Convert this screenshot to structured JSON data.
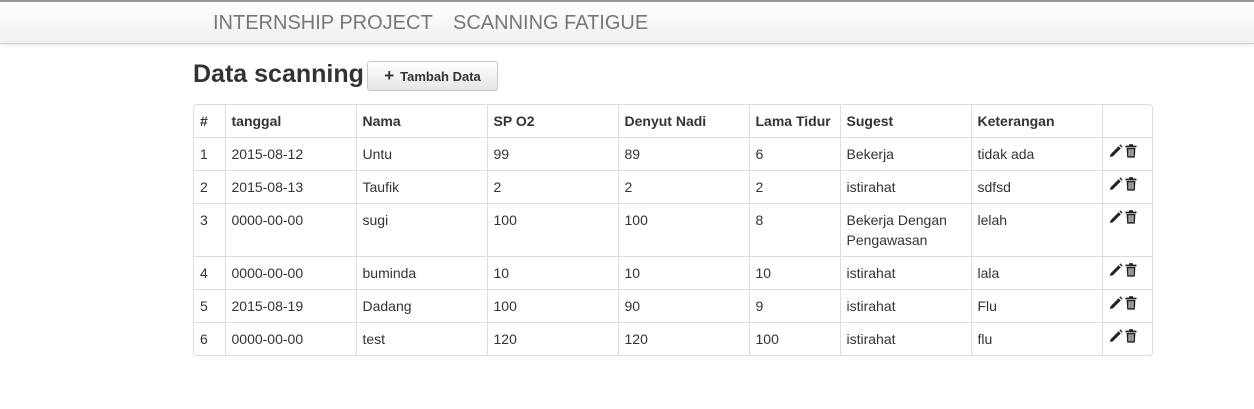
{
  "navbar": {
    "brand": "INTERNSHIP PROJECT",
    "link": "SCANNING FATIGUE"
  },
  "page": {
    "title": "Data scanning",
    "add_button_label": "Tambah Data",
    "add_button_icon": "plus-icon"
  },
  "table": {
    "headers": [
      "#",
      "tanggal",
      "Nama",
      "SP O2",
      "Denyut Nadi",
      "Lama Tidur",
      "Sugest",
      "Keterangan",
      ""
    ],
    "rows": [
      [
        "1",
        "2015-08-12",
        "Untu",
        "99",
        "89",
        "6",
        "Bekerja",
        "tidak ada"
      ],
      [
        "2",
        "2015-08-13",
        "Taufik",
        "2",
        "2",
        "2",
        "istirahat",
        "sdfsd"
      ],
      [
        "3",
        "0000-00-00",
        "sugi",
        "100",
        "100",
        "8",
        "Bekerja Dengan Pengawasan",
        "lelah"
      ],
      [
        "4",
        "0000-00-00",
        "buminda",
        "10",
        "10",
        "10",
        "istirahat",
        "lala"
      ],
      [
        "5",
        "2015-08-19",
        "Dadang",
        "100",
        "90",
        "9",
        "istirahat",
        "Flu"
      ],
      [
        "6",
        "0000-00-00",
        "test",
        "120",
        "120",
        "100",
        "istirahat",
        "flu"
      ]
    ],
    "row_actions": [
      "pencil-icon",
      "trash-icon"
    ]
  },
  "colors": {
    "nav_text": "#777777",
    "text": "#333333",
    "border": "#dddddd",
    "top_line": "#9a9a9a"
  }
}
